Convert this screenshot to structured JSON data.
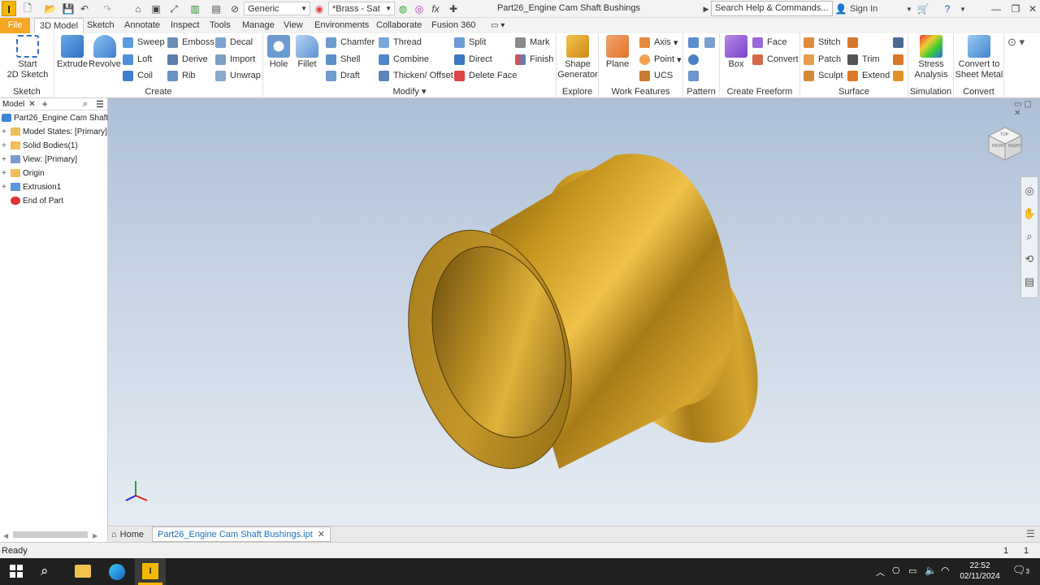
{
  "titlebar": {
    "app_logo": "I",
    "material_dropdown": "Generic",
    "appearance_dropdown": "*Brass - Sat",
    "doc_title": "Part26_Engine Cam Shaft Bushings",
    "search_placeholder": "Search Help & Commands...",
    "sign_in": "Sign In",
    "fx_label": "fx"
  },
  "tabs": [
    "File",
    "3D Model",
    "Sketch",
    "Annotate",
    "Inspect",
    "Tools",
    "Manage",
    "View",
    "Environments",
    "Collaborate",
    "Fusion 360"
  ],
  "ribbon": {
    "sketch": {
      "label": "Sketch",
      "start": "Start",
      "start2": "2D Sketch"
    },
    "create": {
      "label": "Create",
      "extrude": "Extrude",
      "revolve": "Revolve",
      "sweep": "Sweep",
      "emboss": "Emboss",
      "decal": "Decal",
      "loft": "Loft",
      "derive": "Derive",
      "import": "Import",
      "coil": "Coil",
      "rib": "Rib",
      "unwrap": "Unwrap"
    },
    "modify": {
      "label": "Modify",
      "hole": "Hole",
      "fillet": "Fillet",
      "chamfer": "Chamfer",
      "thread": "Thread",
      "split": "Split",
      "shell": "Shell",
      "combine": "Combine",
      "direct": "Direct",
      "draft": "Draft",
      "thicken": "Thicken/ Offset",
      "delete_face": "Delete Face",
      "mark": "Mark",
      "finish": "Finish"
    },
    "explore": {
      "label": "Explore",
      "shape": "Shape",
      "generator": "Generator"
    },
    "work": {
      "label": "Work Features",
      "plane": "Plane",
      "axis": "Axis",
      "point": "Point",
      "ucs": "UCS"
    },
    "pattern": {
      "label": "Pattern"
    },
    "freeform": {
      "label": "Create Freeform",
      "box": "Box",
      "face": "Face",
      "convert": "Convert"
    },
    "surface": {
      "label": "Surface",
      "stitch": "Stitch",
      "patch": "Patch",
      "trim": "Trim",
      "sculpt": "Sculpt",
      "extend": "Extend"
    },
    "simulation": {
      "label": "Simulation",
      "stress": "Stress",
      "analysis": "Analysis"
    },
    "convert": {
      "label": "Convert",
      "to_sheet": "Convert to",
      "sheet_metal": "Sheet Metal"
    }
  },
  "browser": {
    "tab": "Model",
    "items": [
      {
        "label": "Part26_Engine Cam Shaft Bushings",
        "icon": "part-icon"
      },
      {
        "label": "Model States: [Primary]",
        "icon": "folder-icon"
      },
      {
        "label": "Solid Bodies(1)",
        "icon": "folder-icon"
      },
      {
        "label": "View: [Primary]",
        "icon": "view-icon"
      },
      {
        "label": "Origin",
        "icon": "folder-icon"
      },
      {
        "label": "Extrusion1",
        "icon": "extrusion-icon"
      },
      {
        "label": "End of Part",
        "icon": "end-of-part-icon"
      }
    ]
  },
  "viewcube": {
    "front": "FRONT",
    "right": "RIGHT",
    "top": "TOP"
  },
  "doc_tabs": {
    "home": "Home",
    "active": "Part26_Engine Cam Shaft Bushings.ipt"
  },
  "status": {
    "text": "Ready",
    "count1": "1",
    "count2": "1"
  },
  "taskbar": {
    "time": "22:52",
    "date": "02/11/2024",
    "notifications": "3"
  },
  "colors": {
    "accent": "#f5a623",
    "brass": "#b88a1e",
    "viewport_top": "#aebfd6",
    "viewport_bottom": "#e6ecf3"
  }
}
